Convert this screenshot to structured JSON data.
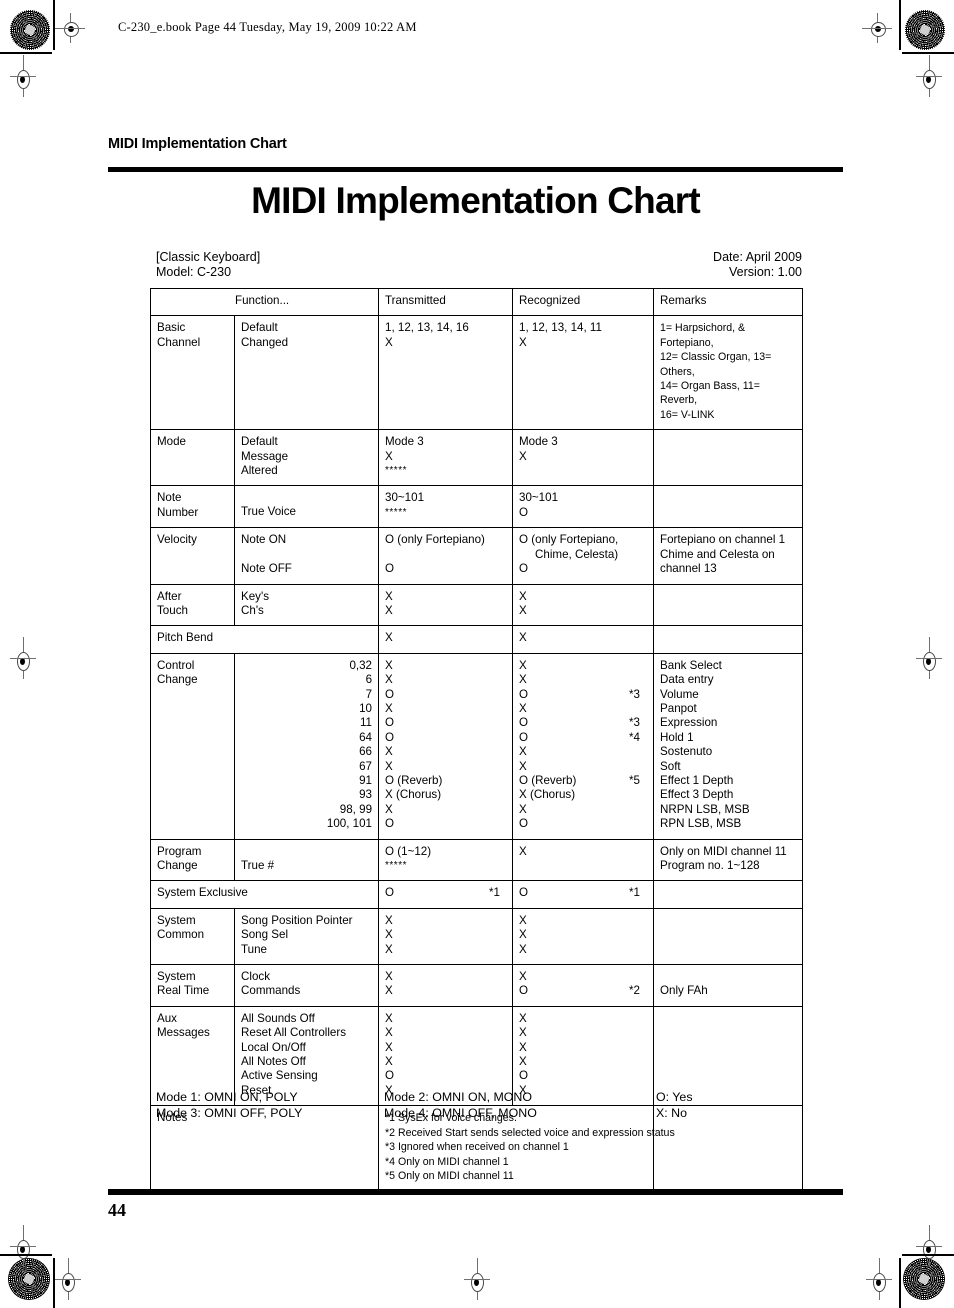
{
  "file_header": "C-230_e.book  Page 44  Tuesday, May 19, 2009  10:22 AM",
  "running_head": "MIDI Implementation Chart",
  "main_title": "MIDI Implementation Chart",
  "meta": {
    "instrument": "[Classic Keyboard]",
    "model": "Model: C-230",
    "date": "Date: April 2009",
    "version": "Version: 1.00"
  },
  "table": {
    "headers": {
      "function": "Function...",
      "transmitted": "Transmitted",
      "recognized": "Recognized",
      "remarks": "Remarks"
    },
    "rows": {
      "basic_channel": {
        "name_l1": "Basic",
        "name_l2": "Channel",
        "sub1": "Default",
        "sub2": "Changed",
        "tx1": "1, 12, 13, 14, 16",
        "tx2": "X",
        "rx1": "1, 12, 13, 14, 11",
        "rx2": "X",
        "rm1": "1= Harpsichord, & Fortepiano,",
        "rm2": "12= Classic Organ, 13= Others,",
        "rm3": "14= Organ Bass, 11= Reverb,",
        "rm4": "16= V-LINK"
      },
      "mode": {
        "name_l1": "Mode",
        "sub1": "Default",
        "sub2": "Message",
        "sub3": "Altered",
        "tx1": "Mode 3",
        "tx2": "X",
        "tx3": "*****",
        "rx1": "Mode 3",
        "rx2": "X"
      },
      "note_number": {
        "name_l1": "Note",
        "name_l2": "Number",
        "sub2": "True Voice",
        "tx1": "30~101",
        "tx2": "*****",
        "rx1": "30~101",
        "rx2": "O"
      },
      "velocity": {
        "name_l1": "Velocity",
        "sub1": "Note ON",
        "sub2": "Note OFF",
        "tx1": "O (only Fortepiano)",
        "tx2": "O",
        "rx1": "O (only Fortepiano,",
        "rx2": "Chime, Celesta)",
        "rx3": "O",
        "rm1": "Fortepiano on channel 1",
        "rm2": "Chime and Celesta on",
        "rm3": "channel 13"
      },
      "after_touch": {
        "name_l1": "After",
        "name_l2": "Touch",
        "sub1": "Key's",
        "sub2": "Ch's",
        "tx1": "X",
        "tx2": "X",
        "rx1": "X",
        "rx2": "X"
      },
      "pitch_bend": {
        "name_l1": "Pitch Bend",
        "tx1": "X",
        "rx1": "X"
      },
      "control_change": {
        "name_l1": "Control",
        "name_l2": "Change",
        "items": [
          {
            "cc": "0,32",
            "tx": "X",
            "rx": "X",
            "ref": "",
            "remark": "Bank Select"
          },
          {
            "cc": "6",
            "tx": "X",
            "rx": "X",
            "ref": "",
            "remark": "Data entry"
          },
          {
            "cc": "7",
            "tx": "O",
            "rx": "O",
            "ref": "*3",
            "remark": "Volume"
          },
          {
            "cc": "10",
            "tx": "X",
            "rx": "X",
            "ref": "",
            "remark": "Panpot"
          },
          {
            "cc": "11",
            "tx": "O",
            "rx": "O",
            "ref": "*3",
            "remark": "Expression"
          },
          {
            "cc": "64",
            "tx": "O",
            "rx": "O",
            "ref": "*4",
            "remark": "Hold 1"
          },
          {
            "cc": "66",
            "tx": "X",
            "rx": "X",
            "ref": "",
            "remark": "Sostenuto"
          },
          {
            "cc": "67",
            "tx": "X",
            "rx": "X",
            "ref": "",
            "remark": "Soft"
          },
          {
            "cc": "91",
            "tx": "O (Reverb)",
            "rx": "O (Reverb)",
            "ref": "*5",
            "remark": "Effect 1 Depth"
          },
          {
            "cc": "93",
            "tx": "X (Chorus)",
            "rx": "X (Chorus)",
            "ref": "",
            "remark": "Effect 3 Depth"
          },
          {
            "cc": "98, 99",
            "tx": "X",
            "rx": "X",
            "ref": "",
            "remark": "NRPN LSB, MSB"
          },
          {
            "cc": "100, 101",
            "tx": "O",
            "rx": "O",
            "ref": "",
            "remark": "RPN LSB, MSB"
          }
        ]
      },
      "program_change": {
        "name_l1": "Program",
        "name_l2": "Change",
        "sub2": "True #",
        "tx1": "O (1~12)",
        "tx2": "*****",
        "rx1": "X",
        "rm1": "Only on MIDI channel 11",
        "rm2": "Program no. 1~128"
      },
      "system_exclusive": {
        "name_l1": "System Exclusive",
        "tx1": "O",
        "tx1_ref": "*1",
        "rx1": "O",
        "rx1_ref": "*1"
      },
      "system_common": {
        "name_l1": "System",
        "name_l2": "Common",
        "sub1": "Song Position Pointer",
        "sub2": "Song Sel",
        "sub3": "Tune",
        "tx1": "X",
        "tx2": "X",
        "tx3": "X",
        "rx1": "X",
        "rx2": "X",
        "rx3": "X"
      },
      "system_real_time": {
        "name_l1": "System",
        "name_l2": "Real Time",
        "sub1": "Clock",
        "sub2": "Commands",
        "tx1": "X",
        "tx2": "X",
        "rx1": "X",
        "rx2": "O",
        "rx2_ref": "*2",
        "rm2": "Only FAh"
      },
      "aux_messages": {
        "name_l1": "Aux",
        "name_l2": "Messages",
        "items": [
          {
            "label": "All Sounds Off",
            "tx": "X",
            "rx": "X"
          },
          {
            "label": "Reset All Controllers",
            "tx": "X",
            "rx": "X"
          },
          {
            "label": "Local On/Off",
            "tx": "X",
            "rx": "X"
          },
          {
            "label": "All Notes Off",
            "tx": "X",
            "rx": "X"
          },
          {
            "label": "Active Sensing",
            "tx": "O",
            "rx": "O"
          },
          {
            "label": "Reset",
            "tx": "X",
            "rx": "X"
          }
        ]
      },
      "notes": {
        "name_l1": "Notes",
        "lines": [
          "*1 SysEx for voice changes.",
          "*2 Received Start sends selected voice and expression status",
          "*3 Ignored when received on channel 1",
          "*4 Only on MIDI channel 1",
          "*5 Only on MIDI channel 11"
        ]
      }
    }
  },
  "legend": {
    "mode1": "Mode 1: OMNI ON, POLY",
    "mode2": "Mode 2: OMNI ON, MONO",
    "yes": "O: Yes",
    "mode3": "Mode 3: OMNI OFF, POLY",
    "mode4": "Mode 4: OMNI OFF, MONO",
    "no": "X: No"
  },
  "footer": {
    "page_number": "44"
  }
}
